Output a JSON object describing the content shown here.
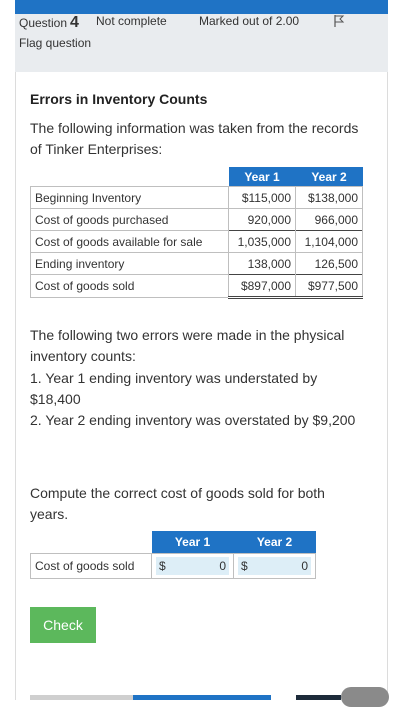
{
  "question": {
    "label": "Question",
    "number": "4",
    "state": "Not complete",
    "marked": "Marked out of 2.00",
    "flag_label": "Flag question"
  },
  "content": {
    "title": "Errors in Inventory Counts",
    "intro": "The following information was taken from the records of Tinker Enterprises:",
    "errors_intro": "The following two errors were made in the physical inventory counts:",
    "error1": "1. Year 1 ending inventory was understated by $18,400",
    "error2": "2. Year 2 ending inventory was overstated by $9,200",
    "prompt": "Compute the correct cost of goods sold for both years."
  },
  "inventory_table": {
    "headers": [
      "Year 1",
      "Year 2"
    ],
    "rows": [
      {
        "label": "Beginning Inventory",
        "y1": "$115,000",
        "y2": "$138,000"
      },
      {
        "label": "Cost of goods purchased",
        "y1": "920,000",
        "y2": "966,000"
      },
      {
        "label": "Cost of goods available for sale",
        "y1": "1,035,000",
        "y2": "1,104,000"
      },
      {
        "label": "Ending inventory",
        "y1": "138,000",
        "y2": "126,500"
      },
      {
        "label": "Cost of goods sold",
        "y1": "$897,000",
        "y2": "$977,500"
      }
    ]
  },
  "answer_table": {
    "headers": [
      "Year 1",
      "Year 2"
    ],
    "row_label": "Cost of goods sold",
    "currency": "$",
    "y1_value": "0",
    "y2_value": "0"
  },
  "check_label": "Check",
  "colors": {
    "accent": "#1f73c5",
    "check_button": "#5cb85c",
    "info_bg": "#e9ecef",
    "input_bg": "#ddeef7"
  },
  "icons": {
    "flag": "flag-icon"
  }
}
